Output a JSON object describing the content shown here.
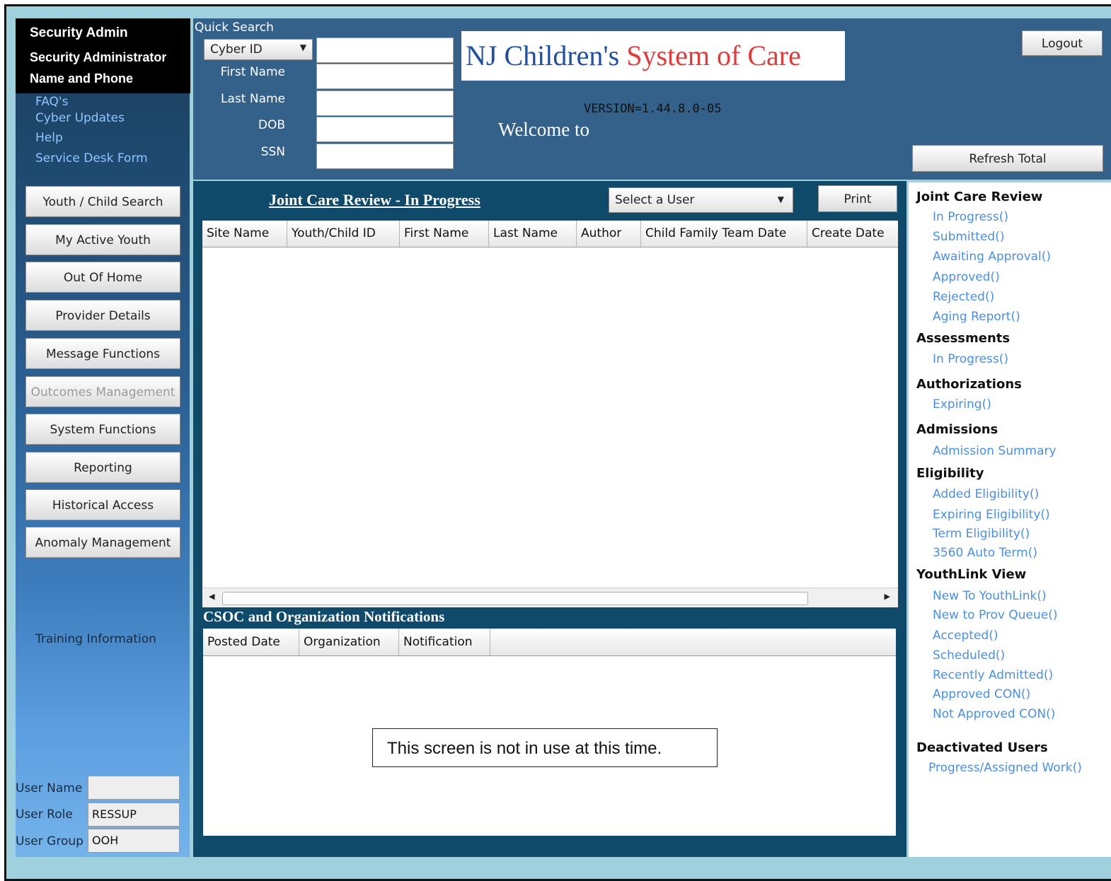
{
  "sidebar": {
    "admin_title": "Security Admin",
    "admin_line1": "Security Administrator",
    "admin_line2": "Name and Phone",
    "links": [
      "FAQ's",
      "Cyber Updates",
      "Help",
      "Service Desk Form"
    ],
    "nav_buttons": [
      "Youth / Child Search",
      "My Active Youth",
      "Out Of Home",
      "Provider Details",
      "Message Functions",
      "Outcomes Management",
      "System Functions",
      "Reporting",
      "Historical Access",
      "Anomaly Management"
    ],
    "training_label": "Training Information",
    "user_name_label": "User Name",
    "user_name_value": "",
    "user_role_label": "User Role",
    "user_role_value": "RESSUP",
    "user_group_label": "User Group",
    "user_group_value": "OOH"
  },
  "header": {
    "quick_search_title": "Quick Search",
    "search_type": "Cyber ID",
    "fields": [
      "First Name",
      "Last Name",
      "DOB",
      "SSN"
    ],
    "logo_part1": "NJ Children's ",
    "logo_part2": "System of Care",
    "version": "VERSION=1.44.8.0-05",
    "welcome": "Welcome to",
    "logout_label": "Logout",
    "refresh_label": "Refresh Total"
  },
  "main": {
    "jcr_title": "Joint Care Review - In Progress",
    "user_select": "Select a User",
    "print_label": "Print",
    "columns": [
      "Site Name",
      "Youth/Child ID",
      "First Name",
      "Last Name",
      "Author",
      "Child Family Team Date",
      "Create Date"
    ],
    "notif_title": "CSOC and Organization Notifications",
    "notif_columns": [
      "Posted Date",
      "Organization",
      "Notification"
    ],
    "notice": "This screen is not in use at this time."
  },
  "right_panel": {
    "jcr_head": "Joint Care Review",
    "jcr_links": [
      "In Progress()",
      "Submitted()",
      "Awaiting Approval()",
      "Approved()",
      "Rejected()",
      "Aging Report()"
    ],
    "assess_head": "Assessments",
    "assess_links": [
      "In Progress()"
    ],
    "auth_head": "Authorizations",
    "auth_links": [
      "Expiring()"
    ],
    "adm_head": "Admissions",
    "adm_links": [
      "Admission Summary"
    ],
    "elig_head": "Eligibility",
    "elig_links": [
      "Added Eligibility()",
      "Expiring Eligibility()",
      "Term Eligibility()",
      "3560 Auto Term()"
    ],
    "yl_head": "YouthLink View",
    "yl_links": [
      "New To YouthLink()",
      "New to Prov Queue()",
      "Accepted()",
      "Scheduled()",
      "Recently Admitted()",
      "Approved CON()",
      "Not Approved CON()"
    ],
    "deact_head": "Deactivated Users",
    "deact_links": [
      "Progress/Assigned Work()"
    ]
  }
}
